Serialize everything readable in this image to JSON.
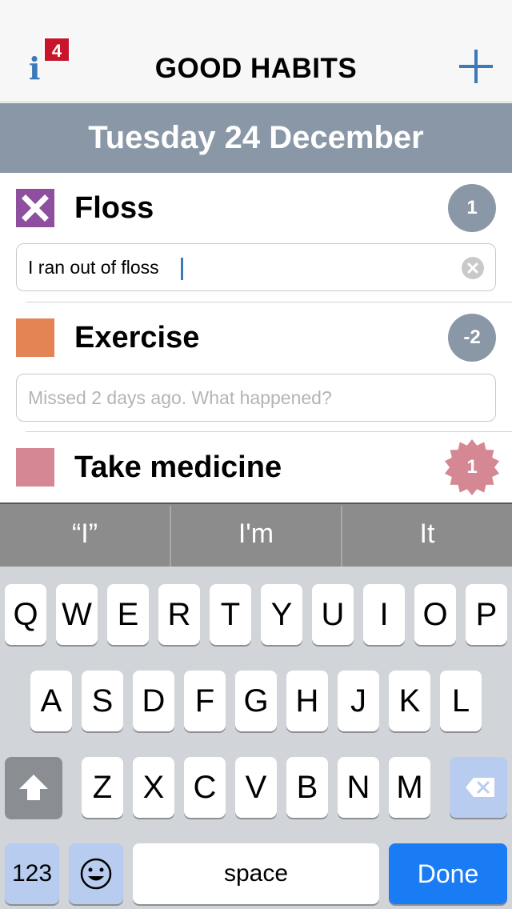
{
  "nav": {
    "title": "GOOD HABITS",
    "badge_count": "4",
    "info_glyph": "i",
    "info_icon": "info-icon",
    "add_icon": "plus-icon"
  },
  "date_header": "Tuesday 24 December",
  "habits": [
    {
      "name": "Floss",
      "color": "#8e4f9f",
      "checked": true,
      "streak": "1",
      "streak_style": "circle",
      "note_value": "I ran out of floss",
      "note_placeholder": ""
    },
    {
      "name": "Exercise",
      "color": "#e48454",
      "checked": false,
      "streak": "-2",
      "streak_style": "circle",
      "note_value": "",
      "note_placeholder": "Missed 2 days ago. What happened?"
    },
    {
      "name": "Take medicine",
      "color": "#d58894",
      "checked": false,
      "streak": "1",
      "streak_style": "starburst",
      "note_value": "",
      "note_placeholder": ""
    }
  ],
  "keyboard": {
    "suggestions": [
      "“I”",
      "I'm",
      "It"
    ],
    "row1": [
      "Q",
      "W",
      "E",
      "R",
      "T",
      "Y",
      "U",
      "I",
      "O",
      "P"
    ],
    "row2": [
      "A",
      "S",
      "D",
      "F",
      "G",
      "H",
      "J",
      "K",
      "L"
    ],
    "row3": [
      "Z",
      "X",
      "C",
      "V",
      "B",
      "N",
      "M"
    ],
    "numbers_label": "123",
    "space_label": "space",
    "done_label": "Done",
    "shift_icon": "shift-icon",
    "delete_icon": "delete-icon",
    "emoji_icon": "emoji-icon",
    "done_color": "#1a7cf5"
  }
}
